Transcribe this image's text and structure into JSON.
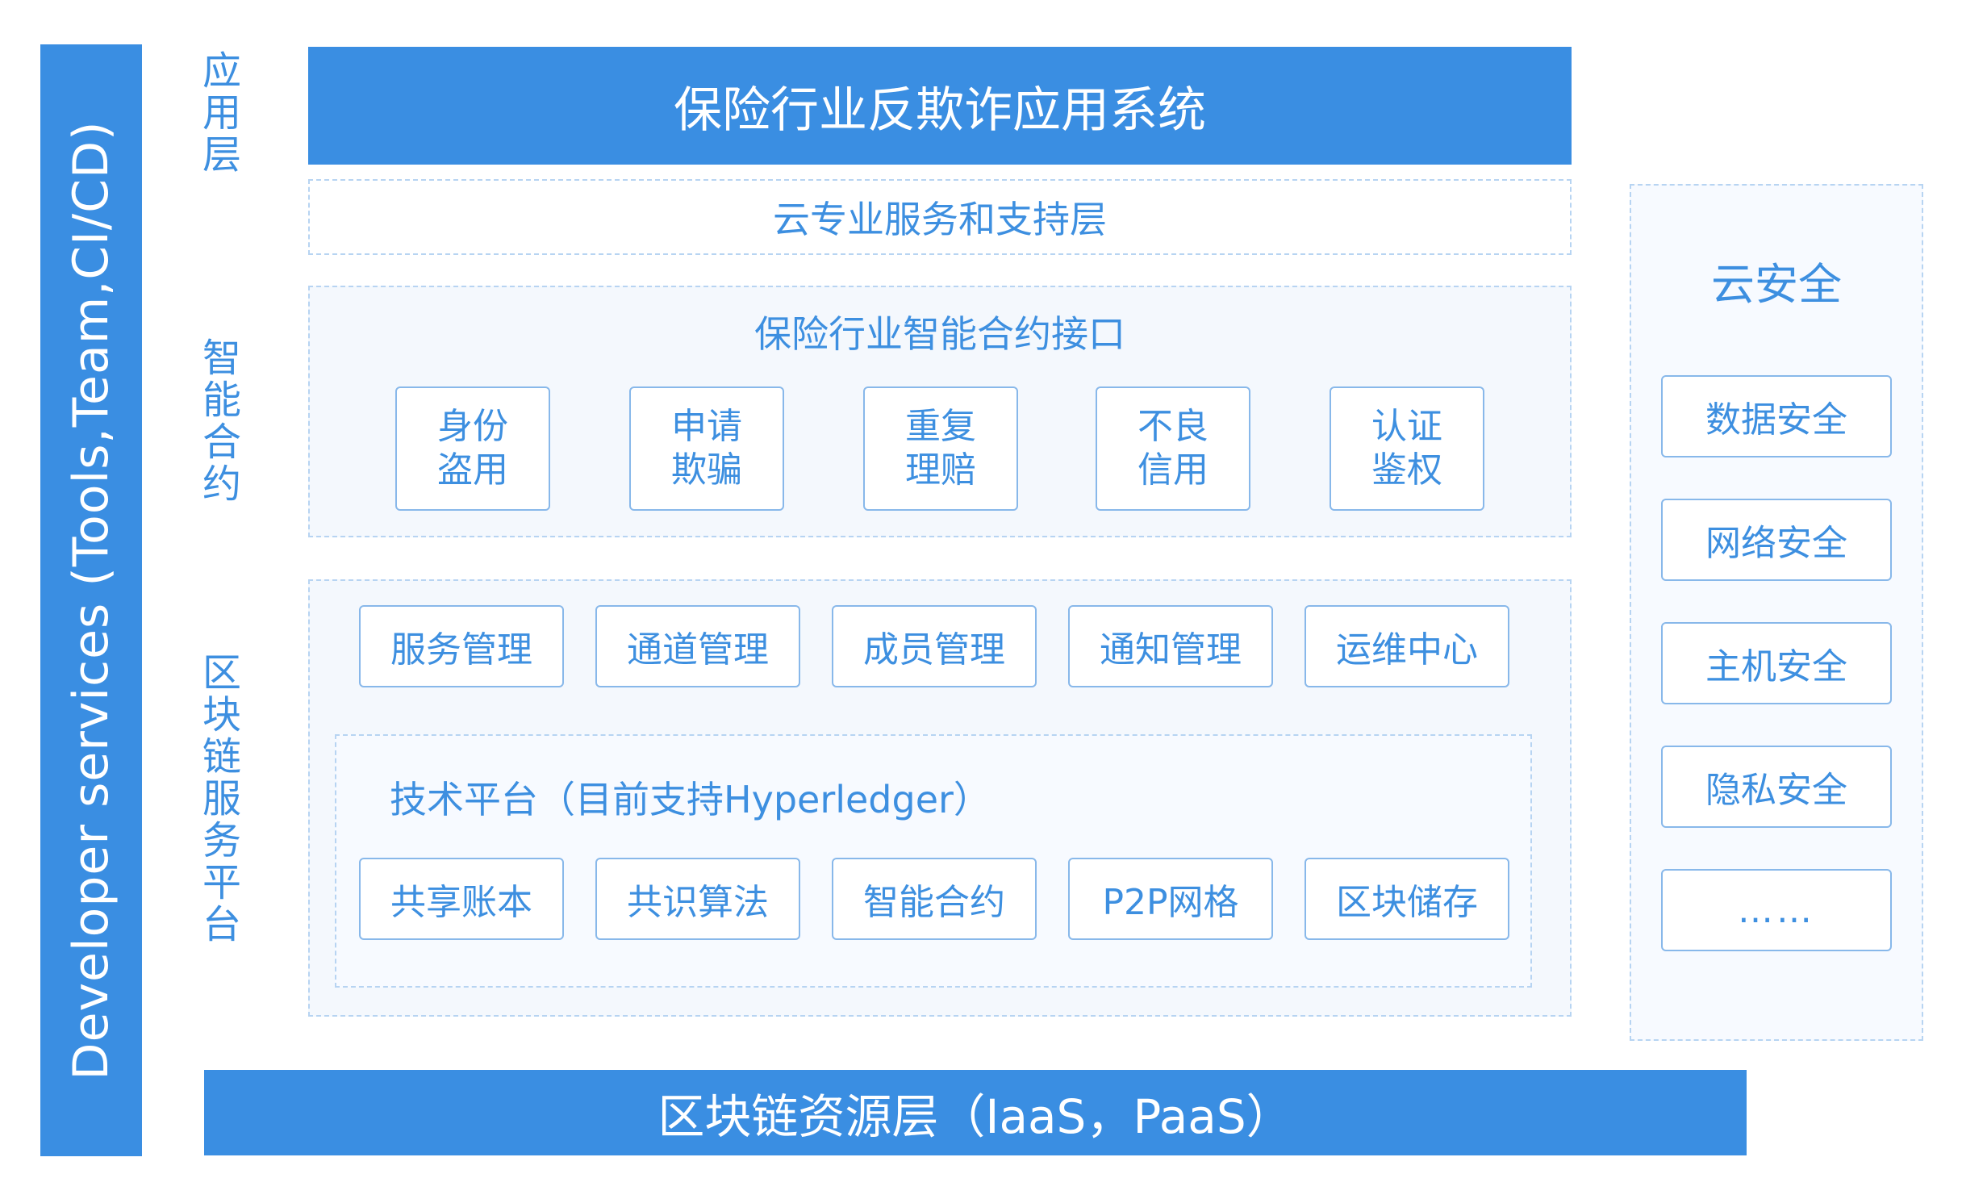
{
  "developer_bar": "Developer services (Tools,Team,CI/CD)",
  "layer_labels": {
    "application": [
      "应",
      "用",
      "层"
    ],
    "smart_contract": [
      "智",
      "能",
      "合",
      "约"
    ],
    "blockchain_service": [
      "区",
      "块",
      "链",
      "服",
      "务",
      "平",
      "台"
    ]
  },
  "app_system": "保险行业反欺诈应用系统",
  "cloud_service_layer": "云专业服务和支持层",
  "contract_interface": {
    "title": "保险行业智能合约接口",
    "items": [
      [
        "身份",
        "盗用"
      ],
      [
        "申请",
        "欺骗"
      ],
      [
        "重复",
        "理赔"
      ],
      [
        "不良",
        "信用"
      ],
      [
        "认证",
        "鉴权"
      ]
    ]
  },
  "management_items": [
    "服务管理",
    "通道管理",
    "成员管理",
    "通知管理",
    "运维中心"
  ],
  "tech_platform": {
    "title": "技术平台（目前支持Hyperledger）",
    "items": [
      "共享账本",
      "共识算法",
      "智能合约",
      "P2P网格",
      "区块储存"
    ]
  },
  "cloud_security": {
    "title": "云安全",
    "items": [
      "数据安全",
      "网络安全",
      "主机安全",
      "隐私安全",
      "……"
    ]
  },
  "resource_layer": "区块链资源层（IaaS，PaaS）"
}
